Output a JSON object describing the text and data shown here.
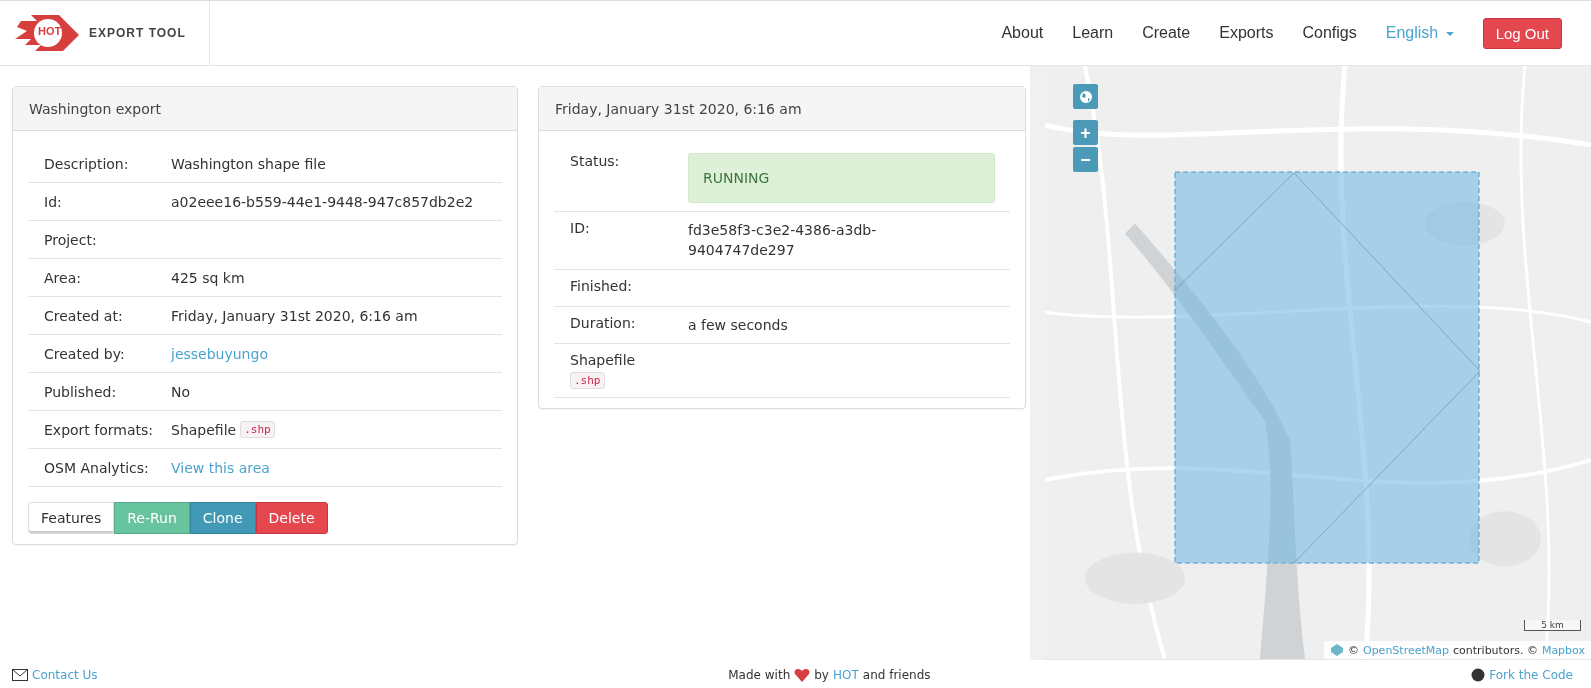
{
  "header": {
    "logo_text": "HOT",
    "title": "EXPORT TOOL",
    "nav": [
      {
        "label": "About"
      },
      {
        "label": "Learn"
      },
      {
        "label": "Create"
      },
      {
        "label": "Exports"
      },
      {
        "label": "Configs"
      }
    ],
    "language": "English",
    "logout": "Log Out"
  },
  "export_panel": {
    "title": "Washington export",
    "rows": [
      {
        "label": "Description:",
        "value": "Washington shape file",
        "kind": "text"
      },
      {
        "label": "Id:",
        "value": "a02eee16-b559-44e1-9448-947c857db2e2",
        "kind": "text"
      },
      {
        "label": "Project:"
      },
      {
        "label": "Area:",
        "value": "425 sq km",
        "kind": "text"
      },
      {
        "label": "Created at:",
        "value": "Friday, January 31st 2020, 6:16 am",
        "kind": "text"
      },
      {
        "label": "Created by:",
        "value": "jessebuyungo",
        "kind": "link"
      },
      {
        "label": "Published:",
        "value": "No",
        "kind": "text"
      },
      {
        "label": "Export formats:",
        "value": "Shapefile",
        "code": ".shp",
        "kind": "text"
      },
      {
        "label": "OSM Analytics:",
        "value": "View this area",
        "kind": "link"
      }
    ],
    "buttons": [
      {
        "label": "Features",
        "kind": "default"
      },
      {
        "label": "Re-Run",
        "kind": "success"
      },
      {
        "label": "Clone",
        "kind": "info"
      },
      {
        "label": "Delete",
        "kind": "danger"
      }
    ]
  },
  "run_panel": {
    "title": "Friday, January 31st 2020, 6:16 am",
    "status_label": "Status:",
    "status": "RUNNING",
    "rows": [
      {
        "label": "ID:",
        "value": "fd3e58f3-c3e2-4386-a3db-9404747de297"
      },
      {
        "label": "Finished:"
      },
      {
        "label": "Duration:",
        "value": "a few seconds"
      }
    ],
    "files": [
      {
        "name": "Shapefile",
        "code": ".shp"
      }
    ]
  },
  "map": {
    "zoom_in": "+",
    "zoom_out": "−",
    "scale": "5 km",
    "attribution": [
      {
        "text": "©",
        "kind": "text"
      },
      {
        "text": "OpenStreetMap",
        "kind": "link"
      },
      {
        "text": "contributors. ©",
        "kind": "text"
      },
      {
        "text": "Mapbox",
        "kind": "link"
      }
    ]
  },
  "footer": {
    "contact": "Contact Us",
    "made_with": "Made with",
    "by": "by",
    "hot": "HOT",
    "friends": "and friends",
    "fork": "Fork the Code"
  }
}
